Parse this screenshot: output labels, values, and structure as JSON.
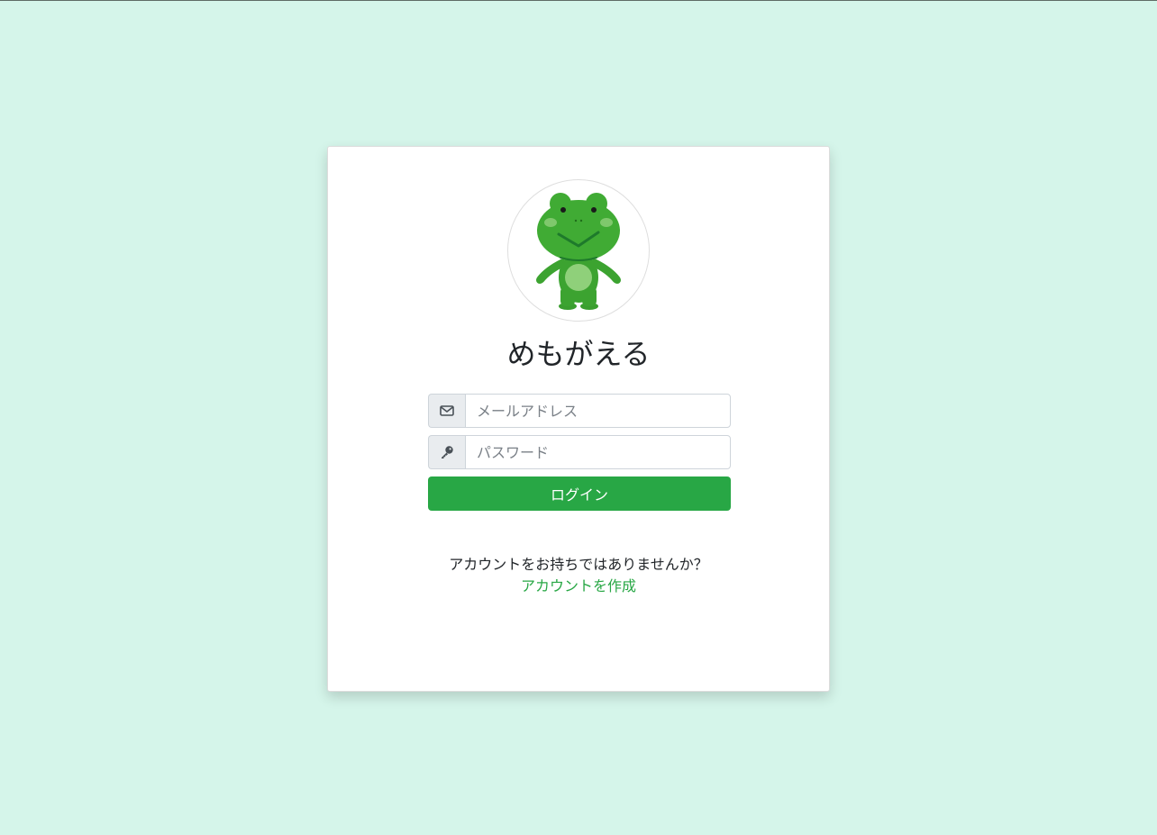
{
  "app": {
    "title": "めもがえる",
    "logo": "frog-mascot"
  },
  "login_form": {
    "email_placeholder": "メールアドレス",
    "email_icon": "envelope-icon",
    "password_placeholder": "パスワード",
    "password_icon": "key-icon",
    "submit_label": "ログイン"
  },
  "signup": {
    "prompt": "アカウントをお持ちではありませんか？",
    "link_label": "アカウントを作成"
  },
  "colors": {
    "background": "#d5f5ea",
    "primary": "#28a745",
    "card": "#ffffff"
  }
}
